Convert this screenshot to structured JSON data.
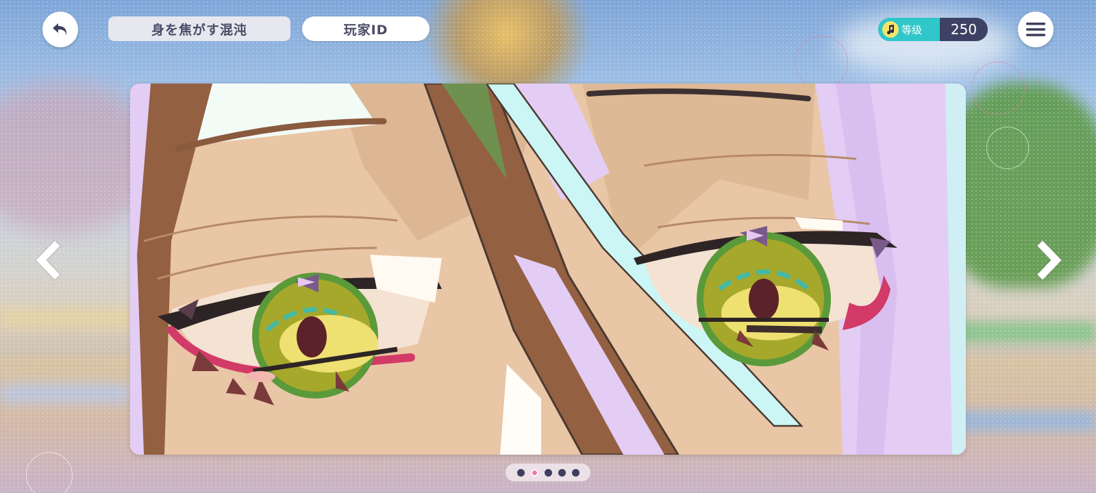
{
  "header": {
    "title": "身を焦がす混沌",
    "player_id_label": "玩家ID",
    "level_label": "等级",
    "level_value": "250"
  },
  "icons": {
    "back": "back-arrow-icon",
    "menu": "hamburger-menu-icon",
    "note": "music-note-icon",
    "prev": "chevron-left-icon",
    "next": "chevron-right-icon"
  },
  "colors": {
    "level_tag": "#2fc7c9",
    "level_bg": "#3d4163",
    "active_dot": "#f07aa8",
    "inactive_dot": "#3e3f5e"
  },
  "gallery": {
    "page_count": 5,
    "active_page": 2
  }
}
